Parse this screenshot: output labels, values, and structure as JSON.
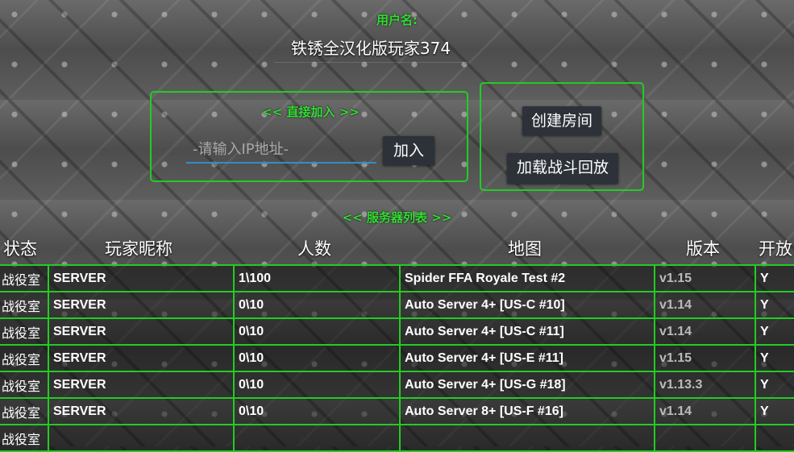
{
  "username": {
    "label": "用户名:",
    "value": "铁锈全汉化版玩家374"
  },
  "direct_join": {
    "title": "<< 直接加入 >>",
    "ip_placeholder": "-请输入IP地址-",
    "join_label": "加入"
  },
  "room": {
    "create_label": "创建房间",
    "replay_label": "加载战斗回放"
  },
  "server_list": {
    "title": "<< 服务器列表 >>",
    "headers": {
      "status": "状态",
      "nickname": "玩家昵称",
      "players": "人数",
      "map": "地图",
      "version": "版本",
      "open": "开放"
    },
    "rows": [
      {
        "status": "战役室",
        "nickname": "SERVER",
        "players": "1\\100",
        "map": "Spider FFA Royale Test #2",
        "version": "v1.15",
        "open": "Y"
      },
      {
        "status": "战役室",
        "nickname": "SERVER",
        "players": "0\\10",
        "map": "Auto Server 4+ [US-C #10]",
        "version": "v1.14",
        "open": "Y"
      },
      {
        "status": "战役室",
        "nickname": "SERVER",
        "players": "0\\10",
        "map": "Auto Server 4+ [US-C #11]",
        "version": "v1.14",
        "open": "Y"
      },
      {
        "status": "战役室",
        "nickname": "SERVER",
        "players": "0\\10",
        "map": "Auto Server 4+ [US-E #11]",
        "version": "v1.15",
        "open": "Y"
      },
      {
        "status": "战役室",
        "nickname": "SERVER",
        "players": "0\\10",
        "map": "Auto Server 4+ [US-G #18]",
        "version": "v1.13.3",
        "open": "Y"
      },
      {
        "status": "战役室",
        "nickname": "SERVER",
        "players": "0\\10",
        "map": "Auto Server 8+ [US-F #16]",
        "version": "v1.14",
        "open": "Y"
      },
      {
        "status": "战役室",
        "nickname": "",
        "players": "",
        "map": "",
        "version": "",
        "open": ""
      }
    ]
  },
  "colors": {
    "accent_green": "#22cc22",
    "label_green": "#33dd33",
    "input_underline": "#2f8fc8",
    "button_bg": "#2c3238"
  }
}
